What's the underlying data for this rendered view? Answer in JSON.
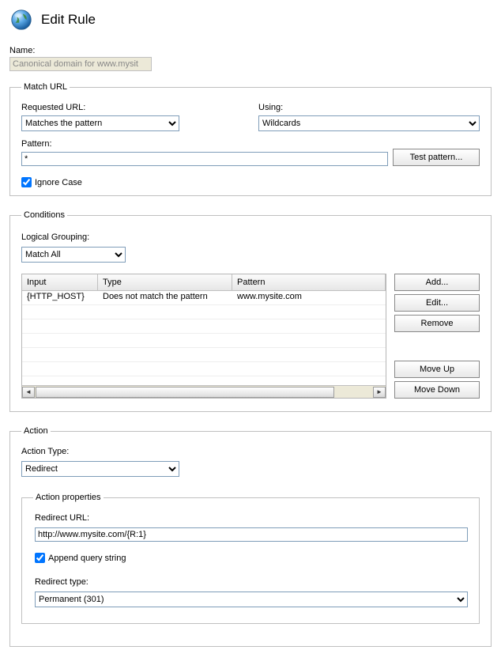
{
  "header": {
    "title": "Edit Rule"
  },
  "name": {
    "label": "Name:",
    "value": "Canonical domain for www.mysit"
  },
  "matchUrl": {
    "legend": "Match URL",
    "requestedUrlLabel": "Requested URL:",
    "requestedUrlValue": "Matches the pattern",
    "usingLabel": "Using:",
    "usingValue": "Wildcards",
    "patternLabel": "Pattern:",
    "patternValue": "*",
    "testPatternLabel": "Test pattern...",
    "ignoreCaseLabel": "Ignore Case"
  },
  "conditions": {
    "legend": "Conditions",
    "logicalGroupingLabel": "Logical Grouping:",
    "logicalGroupingValue": "Match All",
    "columns": {
      "input": "Input",
      "type": "Type",
      "pattern": "Pattern"
    },
    "rows": [
      {
        "input": "{HTTP_HOST}",
        "type": "Does not match the pattern",
        "pattern": "www.mysite.com"
      }
    ],
    "buttons": {
      "add": "Add...",
      "edit": "Edit...",
      "remove": "Remove",
      "moveUp": "Move Up",
      "moveDown": "Move Down"
    }
  },
  "action": {
    "legend": "Action",
    "actionTypeLabel": "Action Type:",
    "actionTypeValue": "Redirect",
    "propsLegend": "Action properties",
    "redirectUrlLabel": "Redirect URL:",
    "redirectUrlValue": "http://www.mysite.com/{R:1}",
    "appendLabel": "Append query string",
    "redirectTypeLabel": "Redirect type:",
    "redirectTypeValue": "Permanent (301)"
  }
}
